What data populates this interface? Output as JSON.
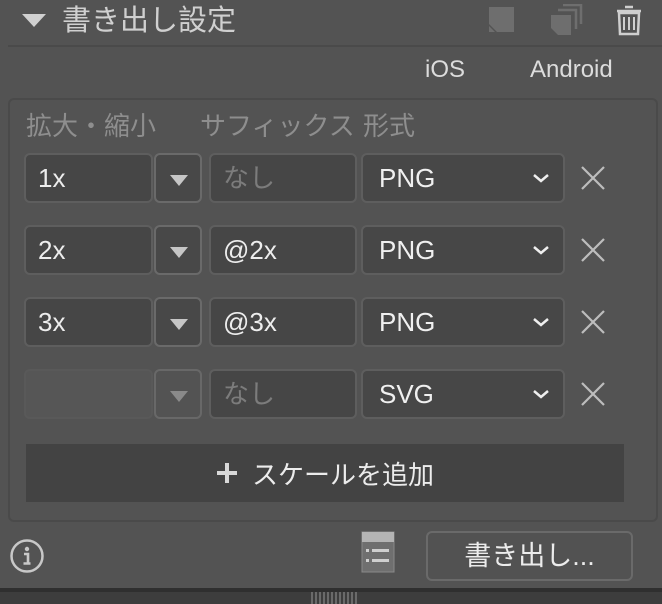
{
  "header": {
    "title": "書き出し設定",
    "collapse_icon": "triangle-down-icon",
    "actions": [
      {
        "name": "export-single-icon",
        "label": "single asset"
      },
      {
        "name": "export-multiple-icon",
        "label": "multiple assets"
      },
      {
        "name": "trash-icon",
        "label": "delete"
      }
    ]
  },
  "presets": {
    "ios": "iOS",
    "android": "Android"
  },
  "columns": {
    "scale": "拡大・縮小",
    "suffix": "サフィックス",
    "format": "形式"
  },
  "rows": [
    {
      "scale": "1x",
      "suffix": "",
      "suffix_placeholder": "なし",
      "format": "PNG",
      "disabled": false
    },
    {
      "scale": "2x",
      "suffix": "@2x",
      "suffix_placeholder": "なし",
      "format": "PNG",
      "disabled": false
    },
    {
      "scale": "3x",
      "suffix": "@3x",
      "suffix_placeholder": "なし",
      "format": "PNG",
      "disabled": false
    },
    {
      "scale": "",
      "suffix": "",
      "suffix_placeholder": "なし",
      "format": "SVG",
      "disabled": true
    }
  ],
  "add_scale": {
    "label": "スケールを追加",
    "icon": "plus-icon"
  },
  "footer": {
    "info_icon": "info-icon",
    "preview_icon": "list-panel-icon",
    "export_label": "書き出し..."
  }
}
